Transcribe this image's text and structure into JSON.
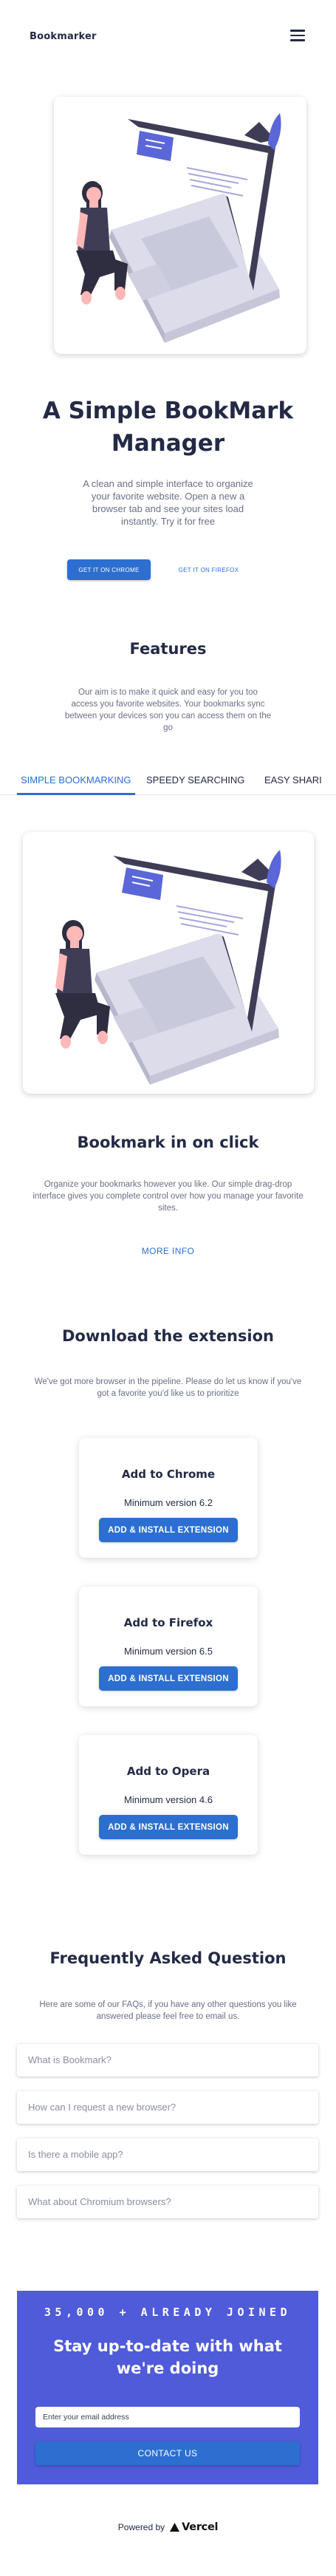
{
  "header": {
    "brand": "Bookmarker",
    "menu_icon": "hamburger-menu-icon"
  },
  "hero": {
    "illustration": "woman-sitting-on-laptop-illustration",
    "title_line1": "A Simple BookMark",
    "title_line2": "Manager",
    "desc_lines": [
      "A clean and simple interface to organize",
      "your favorite website. Open a new a",
      "browser tab and see your sites load",
      "instantly. Try it for free"
    ],
    "chrome_button": "GET IT ON CHROME",
    "firefox_button": "GET IT ON FIREFOX"
  },
  "features": {
    "title": "Features",
    "desc_lines": [
      "Our aim is to make it quick and easy for you too",
      "access you favorite websites. Your bookmarks sync",
      "between your devices son you can access them on the",
      "go"
    ],
    "tabs": [
      {
        "label": "SIMPLE BOOKMARKING",
        "active": true
      },
      {
        "label": "SPEEDY SEARCHING",
        "active": false
      },
      {
        "label": "EASY SHARI",
        "active": false
      }
    ],
    "panel": {
      "illustration": "woman-sitting-on-laptop-illustration",
      "title": "Bookmark in on click",
      "desc_lines": [
        "Organize your bookmarks however you like. Our simple drag-drop",
        "interface gives you complete control over how you manage your favorite",
        "sites."
      ],
      "more_info": "MORE INFO"
    }
  },
  "extensions": {
    "title": "Download the extension",
    "desc_lines": [
      "We've got more browser in the pipeline. Please do let us know if you've",
      "got a favorite you'd like us to prioritize"
    ],
    "cards": [
      {
        "title": "Add to Chrome",
        "version": "Minimum version 6.2",
        "button": "ADD & INSTALL EXTENSION"
      },
      {
        "title": "Add to Firefox",
        "version": "Minimum version 6.5",
        "button": "ADD & INSTALL EXTENSION"
      },
      {
        "title": "Add to Opera",
        "version": "Minimum version 4.6",
        "button": "ADD & INSTALL EXTENSION"
      }
    ]
  },
  "faq": {
    "title": "Frequently Asked Question",
    "desc_lines": [
      "Here are some of our FAQs, if you have any other questions you like",
      "answered please feel free to email us."
    ],
    "items": [
      "What is Bookmark?",
      "How can I request a new browser?",
      "Is there a mobile app?",
      "What about Chromium browsers?"
    ]
  },
  "cta": {
    "count": "35,000 + ALREADY JOINED",
    "title_line1": "Stay up-to-date with what",
    "title_line2": "we're doing",
    "email_placeholder": "Enter your email address",
    "button": "CONTACT US"
  },
  "footer": {
    "powered_by": "Powered by",
    "vercel": "Vercel",
    "vercel_icon": "vercel-triangle-icon"
  },
  "colors": {
    "primary": "#2c6fd1",
    "cta_bg": "#4f5bd8",
    "accent_illustration": "#5b66d9",
    "heading": "#242a45"
  }
}
